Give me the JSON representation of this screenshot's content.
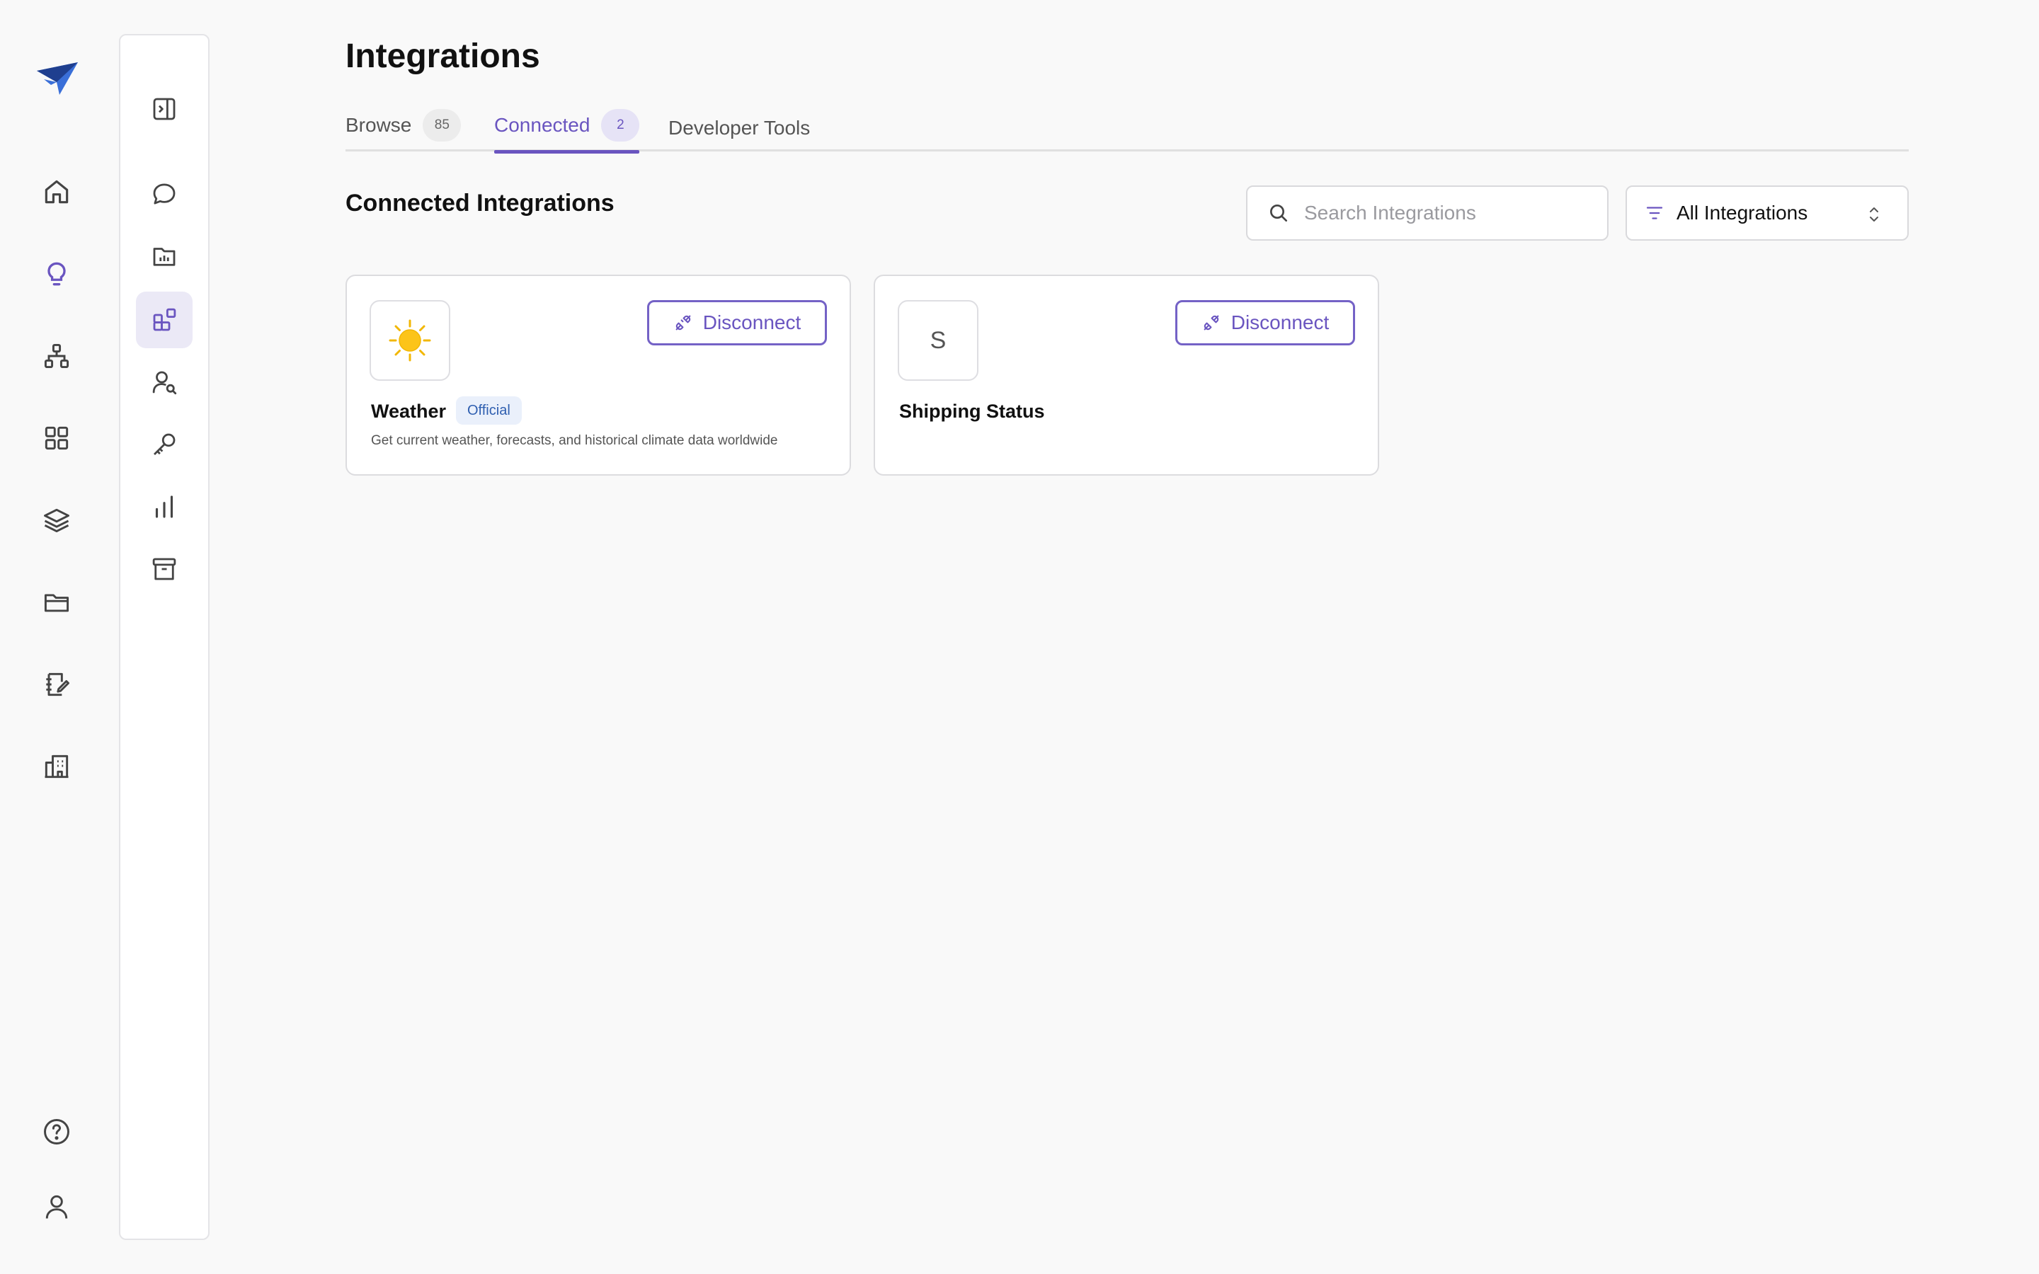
{
  "nav": {
    "rail_icons": [
      "logo-icon",
      "home-icon",
      "lightbulb-icon",
      "hierarchy-icon",
      "grid-icon",
      "layers-icon",
      "folder-icon",
      "notebook-edit-icon",
      "building-icon",
      "help-icon",
      "user-icon"
    ],
    "active_rail_item": "lightbulb-icon",
    "panel_icons": [
      "sidebar-toggle-icon",
      "chat-icon",
      "folder-chart-icon",
      "integrations-icon",
      "user-search-icon",
      "key-icon",
      "bar-chart-icon",
      "archive-icon"
    ],
    "active_panel_item": "integrations-icon"
  },
  "page": {
    "title": "Integrations"
  },
  "tabs": [
    {
      "label": "Browse",
      "count": "85",
      "active": false
    },
    {
      "label": "Connected",
      "count": "2",
      "active": true
    },
    {
      "label": "Developer Tools",
      "count": "",
      "active": false
    }
  ],
  "section": {
    "title": "Connected Integrations"
  },
  "search": {
    "placeholder": "Search Integrations",
    "value": ""
  },
  "filter": {
    "selected": "All Integrations"
  },
  "integrations": [
    {
      "name": "Weather",
      "icon": "sun-icon",
      "badge": "Official",
      "description": "Get current weather, forecasts, and historical climate data worldwide",
      "action_label": "Disconnect"
    },
    {
      "name": "Shipping Status",
      "icon_letter": "S",
      "badge": "",
      "description": "",
      "action_label": "Disconnect"
    }
  ],
  "colors": {
    "accent": "#6a55c0",
    "background": "#f9f9f9",
    "badge_bg": "#eaf0fb",
    "badge_text": "#2f5fb0"
  }
}
